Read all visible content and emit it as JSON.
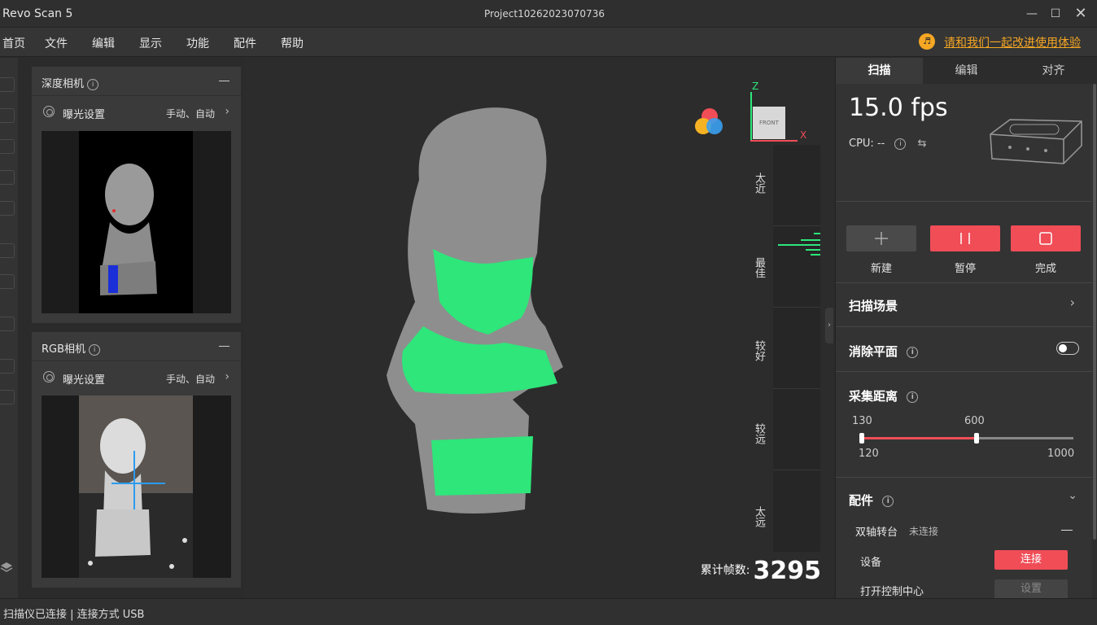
{
  "window": {
    "app_title": "Revo Scan 5",
    "project": "Project10262023070736"
  },
  "menu": [
    "首页",
    "文件",
    "编辑",
    "显示",
    "功能",
    "配件",
    "帮助"
  ],
  "feedback_link": "请和我们一起改进使用体验",
  "depth_camera": {
    "title": "深度相机",
    "exposure_label": "曝光设置",
    "exposure_value": "手动、自动"
  },
  "rgb_camera": {
    "title": "RGB相机",
    "exposure_label": "曝光设置",
    "exposure_value": "手动、自动"
  },
  "axis": {
    "z": "Z",
    "x": "X",
    "view_label": "FRONT"
  },
  "distance_gauge": [
    "太近",
    "最佳",
    "较好",
    "较远",
    "太远"
  ],
  "frame_count": {
    "label": "累计帧数:",
    "value": "3295"
  },
  "tabs": [
    "扫描",
    "编辑",
    "对齐"
  ],
  "scan": {
    "fps": "15.0 fps",
    "cpu": "CPU: --",
    "actions": {
      "new": "新建",
      "pause": "暂停",
      "finish": "完成"
    },
    "scene": "扫描场景",
    "remove_plane": "消除平面",
    "distance": {
      "title": "采集距离",
      "low": "130",
      "high": "600",
      "min": "120",
      "max": "1000"
    },
    "accessories": {
      "title": "配件",
      "turntable": "双轴转台",
      "turntable_status": "未连接",
      "device_label": "设备",
      "connect": "连接",
      "control_center": "打开控制中心",
      "settings": "设置"
    }
  },
  "colors": {
    "accent": "#f04d57",
    "scan_green": "#2ee67a",
    "feedback": "#f5a623"
  },
  "status_bar": "扫描仪已连接 | 连接方式 USB"
}
